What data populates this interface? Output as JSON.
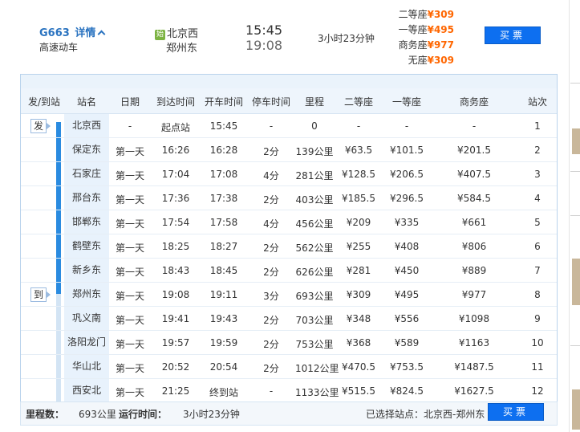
{
  "train": {
    "number": "G663",
    "detail_label": "详情",
    "type": "高速动车",
    "pass_badge": "始",
    "from_station": "北京西",
    "to_station": "郑州东",
    "depart_time": "15:45",
    "arrive_time": "19:08",
    "duration": "3小时23分钟",
    "prices": [
      {
        "seat": "二等座",
        "price": "¥309"
      },
      {
        "seat": "一等座",
        "price": "¥495"
      },
      {
        "seat": "商务座",
        "price": "¥977"
      },
      {
        "seat": "无座",
        "price": "¥309"
      }
    ],
    "buy_label": "买票"
  },
  "table": {
    "headers": [
      "发/到站",
      "站名",
      "日期",
      "到达时间",
      "开车时间",
      "停车时间",
      "里程",
      "二等座",
      "一等座",
      "商务座",
      "站次"
    ],
    "depart_badge": "发",
    "arrive_badge": "到",
    "rows": [
      [
        "北京西",
        "-",
        "起点站",
        "15:45",
        "-",
        "0",
        "-",
        "-",
        "-",
        "1"
      ],
      [
        "保定东",
        "第一天",
        "16:26",
        "16:28",
        "2分",
        "139公里",
        "¥63.5",
        "¥101.5",
        "¥201.5",
        "2"
      ],
      [
        "石家庄",
        "第一天",
        "17:04",
        "17:08",
        "4分",
        "281公里",
        "¥128.5",
        "¥206.5",
        "¥407.5",
        "3"
      ],
      [
        "邢台东",
        "第一天",
        "17:36",
        "17:38",
        "2分",
        "403公里",
        "¥185.5",
        "¥296.5",
        "¥584.5",
        "4"
      ],
      [
        "邯郸东",
        "第一天",
        "17:54",
        "17:58",
        "4分",
        "456公里",
        "¥209",
        "¥335",
        "¥661",
        "5"
      ],
      [
        "鹤壁东",
        "第一天",
        "18:25",
        "18:27",
        "2分",
        "562公里",
        "¥255",
        "¥408",
        "¥806",
        "6"
      ],
      [
        "新乡东",
        "第一天",
        "18:43",
        "18:45",
        "2分",
        "626公里",
        "¥281",
        "¥450",
        "¥889",
        "7"
      ],
      [
        "郑州东",
        "第一天",
        "19:08",
        "19:11",
        "3分",
        "693公里",
        "¥309",
        "¥495",
        "¥977",
        "8"
      ],
      [
        "巩义南",
        "第一天",
        "19:41",
        "19:43",
        "2分",
        "703公里",
        "¥348",
        "¥556",
        "¥1098",
        "9"
      ],
      [
        "洛阳龙门",
        "第一天",
        "19:57",
        "19:59",
        "2分",
        "753公里",
        "¥368",
        "¥589",
        "¥1163",
        "10"
      ],
      [
        "华山北",
        "第一天",
        "20:52",
        "20:54",
        "2分",
        "1012公里",
        "¥470.5",
        "¥753.5",
        "¥1487.5",
        "11"
      ],
      [
        "西安北",
        "第一天",
        "21:25",
        "终到站",
        "-",
        "1133公里",
        "¥515.5",
        "¥824.5",
        "¥1627.5",
        "12"
      ]
    ]
  },
  "footer": {
    "distance_label": "里程数：",
    "distance_value": "693公里",
    "runtime_label": "运行时间：",
    "runtime_value": "3小时23分钟",
    "selected_label": "已选择站点：",
    "selected_value": "北京西-郑州东",
    "buy_label": "买票"
  }
}
